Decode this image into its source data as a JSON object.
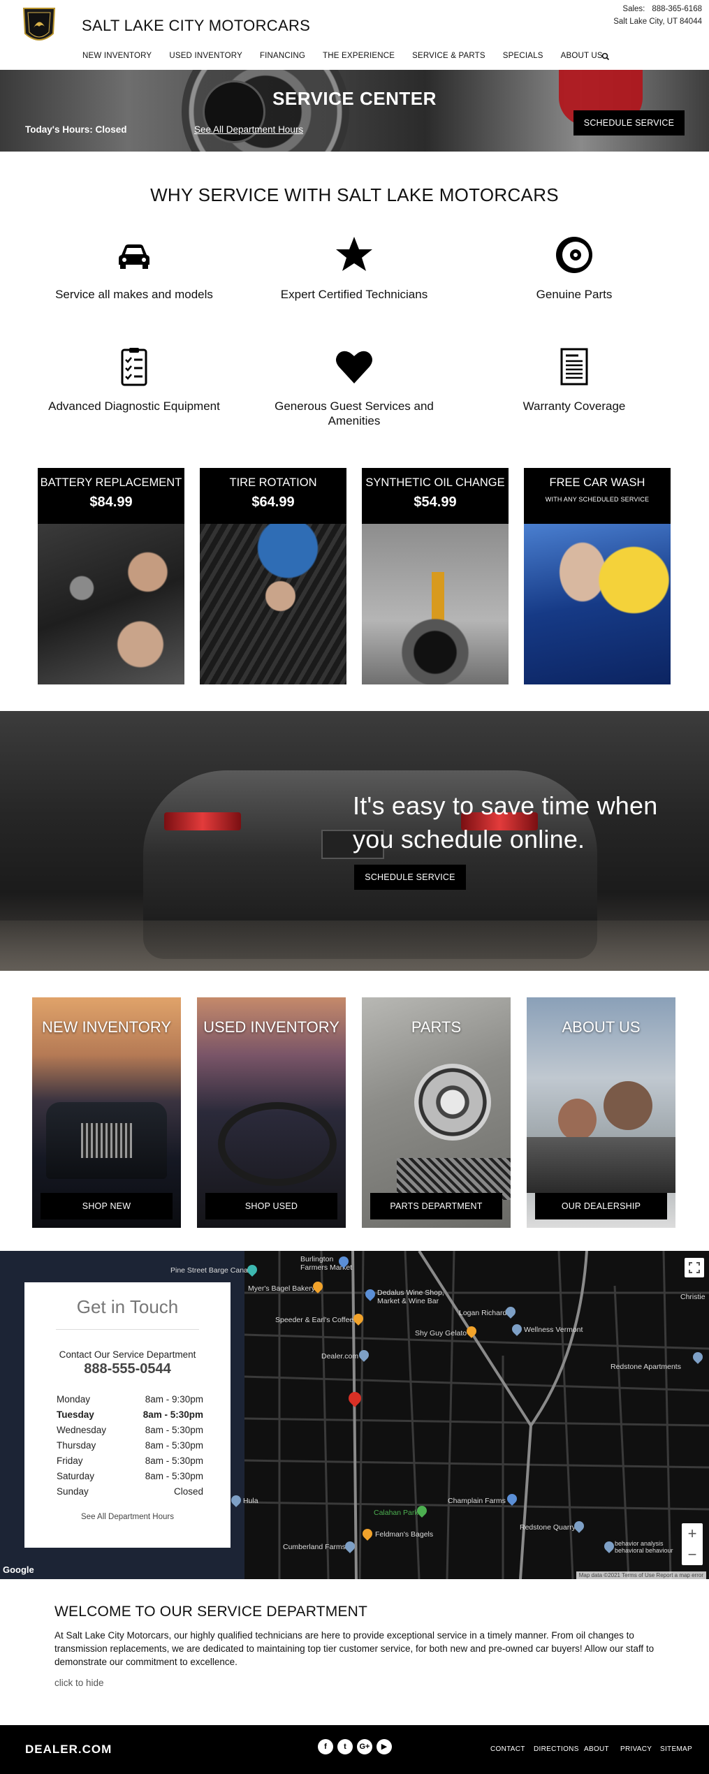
{
  "header": {
    "brand": "SALT LAKE CITY MOTORCARS",
    "sales_label": "Sales:",
    "sales_phone": "888-365-6168",
    "location": "Salt Lake City, UT 84044",
    "nav": [
      "NEW INVENTORY",
      "USED INVENTORY",
      "FINANCING",
      "THE EXPERIENCE",
      "SERVICE & PARTS",
      "SPECIALS",
      "ABOUT US"
    ]
  },
  "hero": {
    "title": "SERVICE CENTER",
    "hours_today": "Today's Hours: Closed",
    "see_hours": "See All Department Hours",
    "schedule_button": "SCHEDULE SERVICE"
  },
  "why": {
    "title": "WHY SERVICE WITH SALT LAKE MOTORCARS",
    "features": [
      {
        "label": "Service all makes and models",
        "icon": "car-icon"
      },
      {
        "label": "Expert Certified Technicians",
        "icon": "star-icon"
      },
      {
        "label": "Genuine Parts",
        "icon": "brake-disc-icon"
      },
      {
        "label": "Advanced Diagnostic Equipment",
        "icon": "checklist-icon"
      },
      {
        "label": "Generous Guest Services and Amenities",
        "icon": "heart-icon"
      },
      {
        "label": "Warranty Coverage",
        "icon": "document-icon"
      }
    ]
  },
  "specials": [
    {
      "title": "BATTERY REPLACEMENT",
      "price": "$84.99"
    },
    {
      "title": "TIRE ROTATION",
      "price": "$64.99"
    },
    {
      "title": "SYNTHETIC OIL CHANGE",
      "price": "$54.99"
    },
    {
      "title": "FREE CAR WASH",
      "subtitle": "WITH ANY SCHEDULED SERVICE"
    }
  ],
  "banner": {
    "text": "It's easy to save time when you schedule online.",
    "button": "SCHEDULE SERVICE"
  },
  "nav_cards": [
    {
      "title": "NEW INVENTORY",
      "button": "SHOP NEW"
    },
    {
      "title": "USED INVENTORY",
      "button": "SHOP USED"
    },
    {
      "title": "PARTS",
      "button": "PARTS DEPARTMENT"
    },
    {
      "title": "ABOUT US",
      "button": "OUR DEALERSHIP"
    }
  ],
  "map": {
    "pois": [
      "Pine Street Barge Canal",
      "Burlington Farmers Market",
      "Myer's Bagel Bakery",
      "Dedalus Wine Shop, Market & Wine Bar",
      "Logan Richard",
      "Christie",
      "Speeder & Earl's Coffee",
      "Shy Guy Gelato",
      "Wellness Vermont",
      "Dealer.com",
      "Redstone Apartments",
      "Hula",
      "Champlain Farms",
      "Calahan Park",
      "Feldman's Bagels",
      "Redstone Quarry",
      "Cumberland Farms",
      "behavior analysis behavioral behaviour"
    ],
    "google": "Google",
    "attribution": "Map data ©2021  Terms of Use  Report a map error",
    "zoom_in": "+",
    "zoom_out": "−"
  },
  "contact": {
    "title": "Get in Touch",
    "dept_label": "Contact Our Service Department",
    "phone": "888-555-0544",
    "hours": [
      {
        "day": "Monday",
        "time": "8am - 9:30pm"
      },
      {
        "day": "Tuesday",
        "time": "8am - 5:30pm"
      },
      {
        "day": "Wednesday",
        "time": "8am - 5:30pm"
      },
      {
        "day": "Thursday",
        "time": "8am - 5:30pm"
      },
      {
        "day": "Friday",
        "time": "8am - 5:30pm"
      },
      {
        "day": "Saturday",
        "time": "8am - 5:30pm"
      },
      {
        "day": "Sunday",
        "time": "Closed"
      }
    ],
    "see_all": "See All Department Hours"
  },
  "welcome": {
    "title": "WELCOME TO OUR SERVICE DEPARTMENT",
    "body": "At Salt Lake City Motorcars, our highly qualified technicians are here to provide exceptional service in a timely manner. From oil changes to transmission replacements, we are dedicated to maintaining top tier customer service, for both new and pre-owned car buyers! Allow our staff to demonstrate our commitment to excellence.",
    "hide_link": "click to hide"
  },
  "footer": {
    "logo": "DEALER.COM",
    "social": [
      "f",
      "t",
      "G+",
      "▶"
    ],
    "links": [
      "CONTACT",
      "DIRECTIONS",
      "ABOUT",
      "PRIVACY",
      "SITEMAP"
    ]
  },
  "colors": {
    "black": "#000000",
    "map_bg": "#101010",
    "water": "#1c2435",
    "pin_red": "#d93025",
    "pin_orange": "#f2a32b",
    "pin_blue": "#5b8fd6"
  }
}
